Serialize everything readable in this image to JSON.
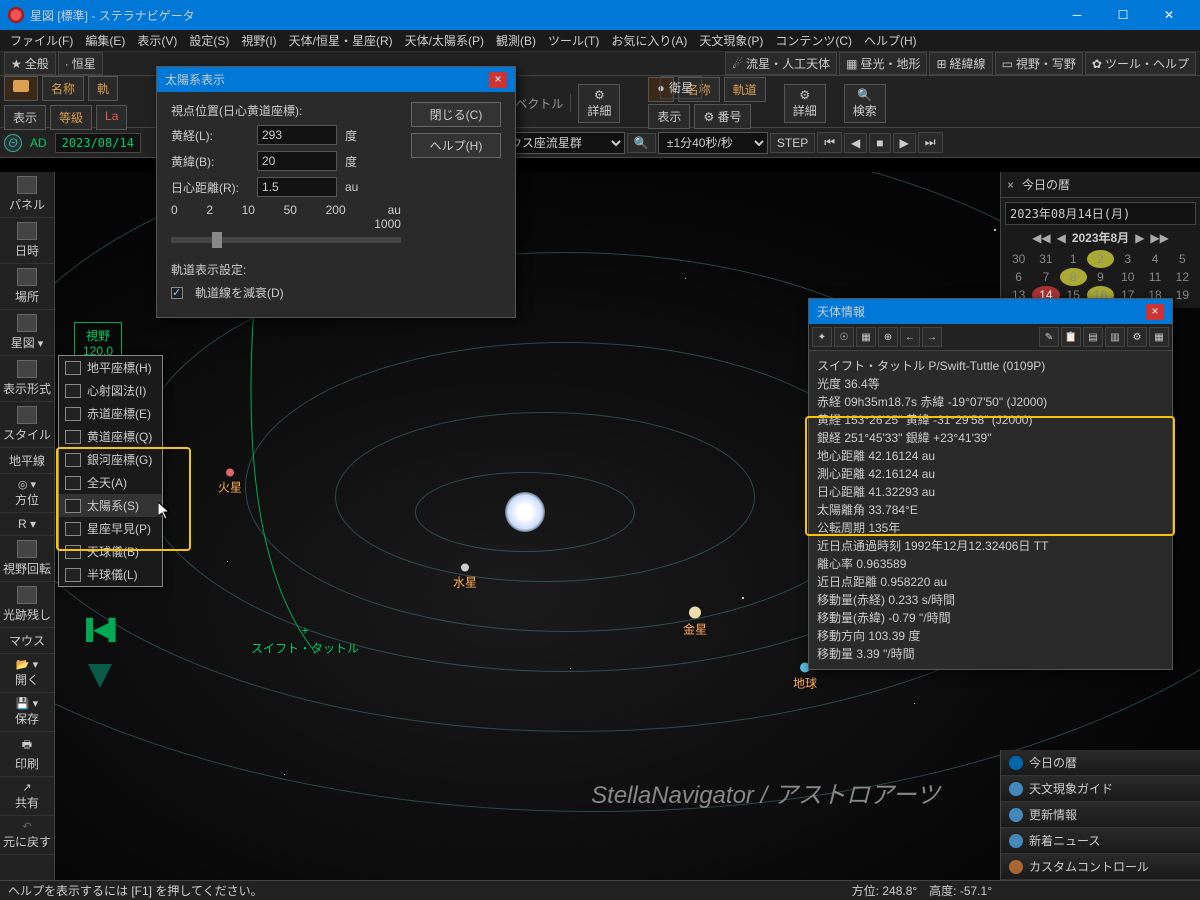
{
  "window": {
    "title": "星図 [標準] - ステラナビゲータ"
  },
  "menubar": [
    "ファイル(F)",
    "編集(E)",
    "表示(V)",
    "設定(S)",
    "視野(I)",
    "天体/恒星・星座(R)",
    "天体/太陽系(P)",
    "観測(B)",
    "ツール(T)",
    "お気に入り(A)",
    "天文現象(P)",
    "コンテンツ(C)",
    "ヘルプ(H)"
  ],
  "tabs1": [
    "全般",
    "恒星"
  ],
  "tabs2": [
    "流星・人工天体",
    "昼光・地形",
    "経緯線",
    "視野・写野",
    "ツール・ヘルプ"
  ],
  "sub2": {
    "satellite": "衛星",
    "name": "名称",
    "orbit": "軌道",
    "number": "番号",
    "detail": "詳細",
    "search": "検索",
    "display": "表示",
    "grade": "等級"
  },
  "datebar": {
    "ad": "AD",
    "date": "2023/08/14",
    "sel": "ペルセウス座流星群",
    "step": "±1分40秒/秒"
  },
  "left_items": [
    "パネル",
    "日時",
    "場所",
    "星図",
    "表示形式",
    "スタイル",
    "地平線",
    "方位",
    "R ▾",
    "視野回転",
    "光跡残し",
    "マウス",
    "開く",
    "保存",
    "印刷",
    "共有",
    "元に戻す"
  ],
  "fov_label": "視野",
  "fov_val": "120.0",
  "ctx": [
    "地平座標(H)",
    "心射図法(I)",
    "赤道座標(E)",
    "黄道座標(Q)",
    "銀河座標(G)",
    "全天(A)",
    "太陽系(S)",
    "星座早見(P)",
    "天球儀(B)",
    "半球儀(L)"
  ],
  "solar_dlg": {
    "title": "太陽系表示",
    "viewpoint": "視点位置(日心黄道座標):",
    "lon_label": "黄経(L):",
    "lon": "293",
    "deg": "度",
    "lat_label": "黄緯(B):",
    "lat": "20",
    "dist_label": "日心距離(R):",
    "dist": "1.5",
    "au": "au",
    "scale": [
      "0",
      "2",
      "10",
      "50",
      "200",
      "au",
      "1000"
    ],
    "orbit_setting": "軌道表示設定:",
    "dim_orbit": "軌道線を減衰(D)",
    "close": "閉じる(C)",
    "help": "ヘルプ(H)"
  },
  "planets": {
    "mars": "火星",
    "mercury": "水星",
    "venus": "金星",
    "earth": "地球",
    "swift": "スイフト・タットル"
  },
  "watermark": "StellaNavigator / アストロアーツ",
  "statusbar": {
    "help": "ヘルプを表示するには [F1] を押してください。",
    "az": "方位: 248.8°",
    "alt": "高度: -57.1°"
  },
  "right": {
    "today": "今日の暦",
    "datebadge": "2023年08月14日(月)",
    "monthyear": "2023年8月",
    "weekdays": [
      "30",
      "31",
      "1",
      "2",
      "3",
      "4",
      "5"
    ],
    "row2": [
      "6",
      "7",
      "8",
      "9",
      "10",
      "11",
      "12"
    ],
    "row3": [
      "13",
      "14",
      "15",
      "16",
      "17",
      "18",
      "19"
    ],
    "links": [
      "今日の暦",
      "天文現象ガイド",
      "更新情報",
      "新着ニュース",
      "カスタムコントロール"
    ]
  },
  "info": {
    "title": "天体情報",
    "lines": [
      "スイフト・タットル P/Swift-Tuttle (0109P)",
      "光度 36.4等",
      "赤経 09h35m18.7s  赤緯 -19°07'50\" (J2000)",
      "黄経 153°26'25\"   黄緯 -31°29'58\" (J2000)",
      "銀経 251°45'33\"   銀緯 +23°41'39\""
    ],
    "boxed": [
      "地心距離 42.16124 au",
      "測心距離 42.16124 au",
      "日心距離 41.32293 au",
      "太陽離角 33.784°E",
      "公転周期 135年",
      "近日点通過時刻 1992年12月12.32406日  TT",
      "離心率 0.963589",
      "近日点距離 0.958220 au"
    ],
    "after": [
      "移動量(赤経) 0.233 s/時間",
      "移動量(赤緯) -0.79 \"/時間",
      "移動方向 103.39 度",
      "移動量    3.39 \"/時間"
    ]
  }
}
